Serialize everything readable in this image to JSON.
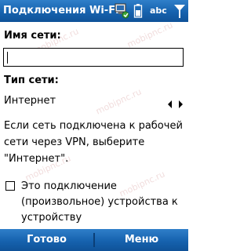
{
  "title_bar": {
    "title": "Подключения Wi-Fi",
    "input_mode": "abc",
    "icons": [
      "connectivity-icon",
      "battery-icon",
      "input-mode-indicator",
      "signal-icon"
    ]
  },
  "form": {
    "network_name_label": "Имя сети:",
    "network_name_value": "",
    "network_type_label": "Тип сети:",
    "network_type_value": "Интернет",
    "help_text": "Если сеть подключена к рабочей сети через VPN, выберите \"Интернет\".",
    "checkbox_label": "Это подключение (произвольное) устройства к устройству",
    "checkbox_checked": false
  },
  "softkeys": {
    "left": "Готово",
    "right": "Меню"
  },
  "watermark": "mobipnc.ru",
  "colors": {
    "bar_blue": "#1662ae",
    "text": "#000000",
    "background": "#ffffff"
  }
}
